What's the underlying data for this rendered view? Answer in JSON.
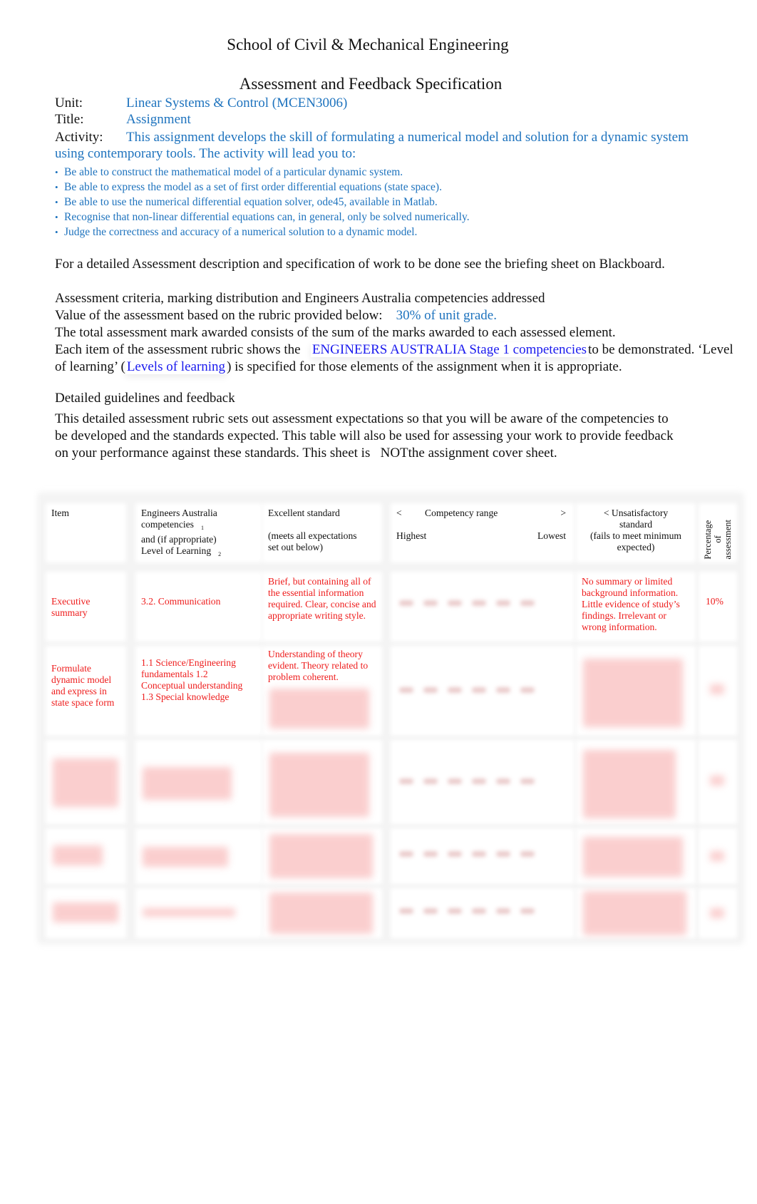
{
  "header": {
    "school": "School of Civil & Mechanical Engineering",
    "title": "Assessment and Feedback Specification"
  },
  "meta": {
    "unit_label": "Unit:",
    "unit_value": "Linear Systems & Control (MCEN3006)",
    "title_label": "Title:",
    "title_value": "Assignment",
    "activity_label": "Activity:",
    "activity_line1": "This assignment develops the skill of formulating a numerical model and solution for a dynamic system",
    "activity_line2": "using contemporary tools.   The activity will lead you to:"
  },
  "outcomes": [
    "Be able to construct the mathematical model of a particular dynamic system.",
    "Be able to express the model as a set of first order differential equations (state space).",
    "Be able to use the numerical differential equation solver, ode45, available in Matlab.",
    "Recognise that non-linear differential equations can, in general, only be solved numerically.",
    "Judge the correctness and accuracy of a numerical solution to a dynamic model."
  ],
  "bullet_glyph": "•",
  "briefing": "For a detailed Assessment description and specification of work to be done see the briefing sheet on Blackboard.",
  "criteria": {
    "heading": "Assessment criteria, marking distribution and Engineers Australia competencies addressed",
    "value_label": "Value of the assessment based on the rubric provided below:",
    "value": "30% of unit grade.",
    "total_line": "The total assessment mark awarded consists of the sum of the marks awarded to each assessed element.",
    "each_pre": "Each item of the assessment rubric shows the",
    "ea_link": "ENGINEERS AUSTRALIA Stage 1 competencies",
    "each_post": "to be demonstrated.   ‘Level",
    "lol_pre": "of learning’ (",
    "lol_link": "Levels of learning",
    "lol_post": ") is specified for those elements of the assignment when it is appropriate."
  },
  "guidelines": {
    "heading": "Detailed guidelines and feedback",
    "line1": "This detailed assessment rubric sets out assessment expectations so that you will be aware of the competencies to",
    "line2": "be developed and the standards expected. This table will also be used for assessing your work to provide feedback",
    "line3_pre": "on your performance against these standards. This sheet is",
    "line3_not": "NOT",
    "line3_post": "the assignment cover sheet."
  },
  "table": {
    "headers": {
      "item": "Item",
      "ea_line1": "Engineers Australia",
      "ea_line2": "competencies",
      "ea_fn1": "1",
      "ea_line3": "and  (if appropriate)",
      "ea_line4": "Level of Learning",
      "ea_fn2": "2",
      "excellent_line1": "Excellent standard",
      "excellent_line2": "(meets all expectations",
      "excellent_line3": "set out below)",
      "range_left": "<",
      "range_label": "Competency range",
      "range_right": ">",
      "range_high": "Highest",
      "range_low": "Lowest",
      "unsat_line1": "< Unsatisfactory",
      "unsat_line2": "standard",
      "unsat_line3": "(fails to meet minimum",
      "unsat_line4": "expected)",
      "pct_line1": "Percentage",
      "pct_line2": "of",
      "pct_line3": "assessment"
    },
    "rows": [
      {
        "item": "Executive summary",
        "competency": "3.2. Communication",
        "excellent": "Brief, but containing all of the essential information required. Clear, concise and appropriate writing style.",
        "unsatisfactory": "No summary or limited background information. Little evidence   of study’s findings.   Irrelevant or wrong information.",
        "percentage": "10%"
      },
      {
        "item": "Formulate dynamic model and express in state space form",
        "competency": "1.1 Science/Engineering fundamentals 1.2 Conceptual understanding 1.3 Special knowledge",
        "excellent": "Understanding of theory evident. Theory related to problem coherent."
      }
    ]
  }
}
